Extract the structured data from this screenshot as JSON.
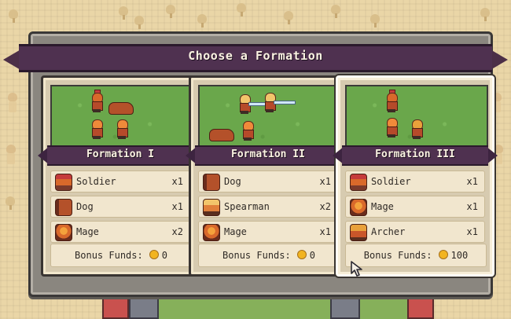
{
  "dialog": {
    "title": "Choose a Formation"
  },
  "formations": [
    {
      "name": "Formation I",
      "units": [
        {
          "icon": "soldier-icon",
          "name": "Soldier",
          "count": "x1"
        },
        {
          "icon": "dog-icon",
          "name": "Dog",
          "count": "x1"
        },
        {
          "icon": "mage-icon",
          "name": "Mage",
          "count": "x2"
        }
      ],
      "bonus_label": "Bonus Funds:",
      "bonus_value": "0",
      "selected": false
    },
    {
      "name": "Formation II",
      "units": [
        {
          "icon": "dog-icon",
          "name": "Dog",
          "count": "x1"
        },
        {
          "icon": "spearman-icon",
          "name": "Spearman",
          "count": "x2"
        },
        {
          "icon": "mage-icon",
          "name": "Mage",
          "count": "x1"
        }
      ],
      "bonus_label": "Bonus Funds:",
      "bonus_value": "0",
      "selected": false
    },
    {
      "name": "Formation III",
      "units": [
        {
          "icon": "soldier-icon",
          "name": "Soldier",
          "count": "x1"
        },
        {
          "icon": "mage-icon",
          "name": "Mage",
          "count": "x1"
        },
        {
          "icon": "archer-icon",
          "name": "Archer",
          "count": "x1"
        }
      ],
      "bonus_label": "Bonus Funds:",
      "bonus_value": "100",
      "selected": true
    }
  ],
  "colors": {
    "banner": "#4f3150",
    "grass": "#6aa74b",
    "card": "#d7cbb0",
    "coin": "#f2b420"
  }
}
